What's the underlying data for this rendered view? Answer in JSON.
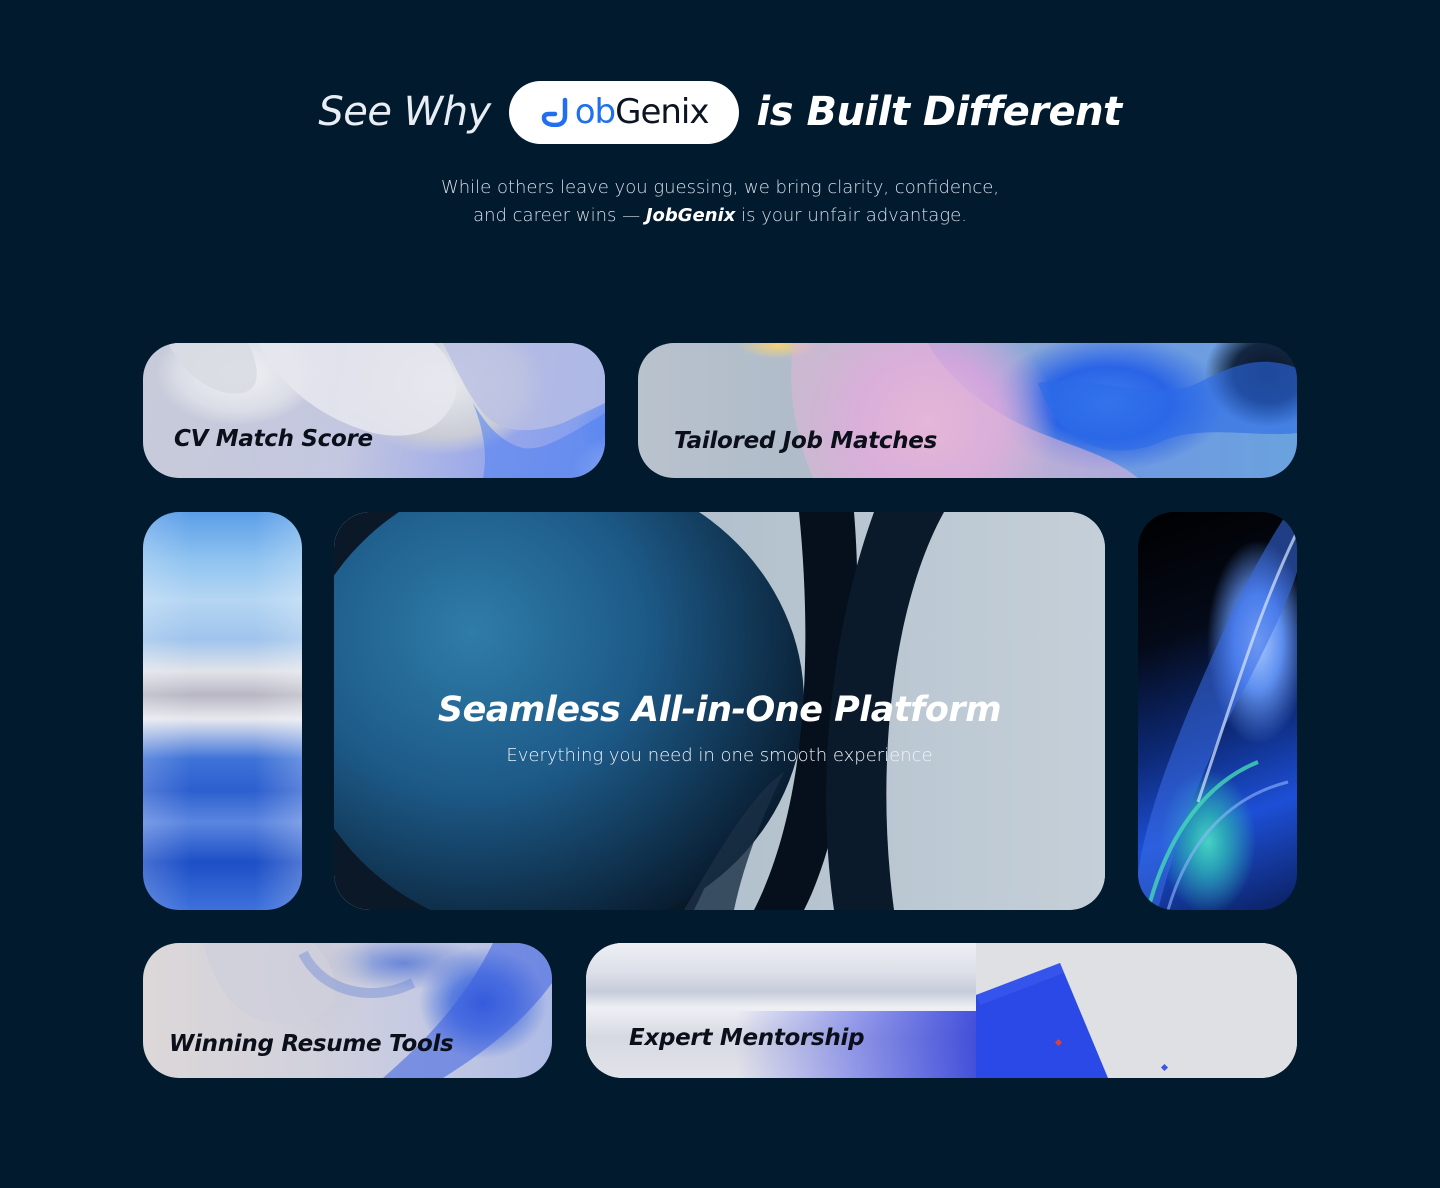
{
  "header": {
    "prefix": "See Why",
    "logo": {
      "j": "J",
      "ob": "ob",
      "genix": "Genix"
    },
    "suffix": "is Built Different"
  },
  "subtitle": {
    "line1": "While others leave you guessing, we bring clarity, confidence,",
    "line2_start": "and career wins —",
    "line2_brand": "JobGenix",
    "line2_end": "is your unfair advantage."
  },
  "cards": {
    "cv_match": {
      "label": "CV Match Score"
    },
    "tailored": {
      "label": "Tailored Job Matches"
    },
    "platform": {
      "title": "Seamless All-in-One Platform",
      "subtitle": "Everything you need in one smooth experience"
    },
    "winning": {
      "label": "Winning Resume Tools"
    },
    "expert": {
      "label": "Expert Mentorship"
    }
  },
  "colors": {
    "background": "#021a2e",
    "brand_blue": "#1f6ff0",
    "logo_dark": "#0b1422"
  }
}
